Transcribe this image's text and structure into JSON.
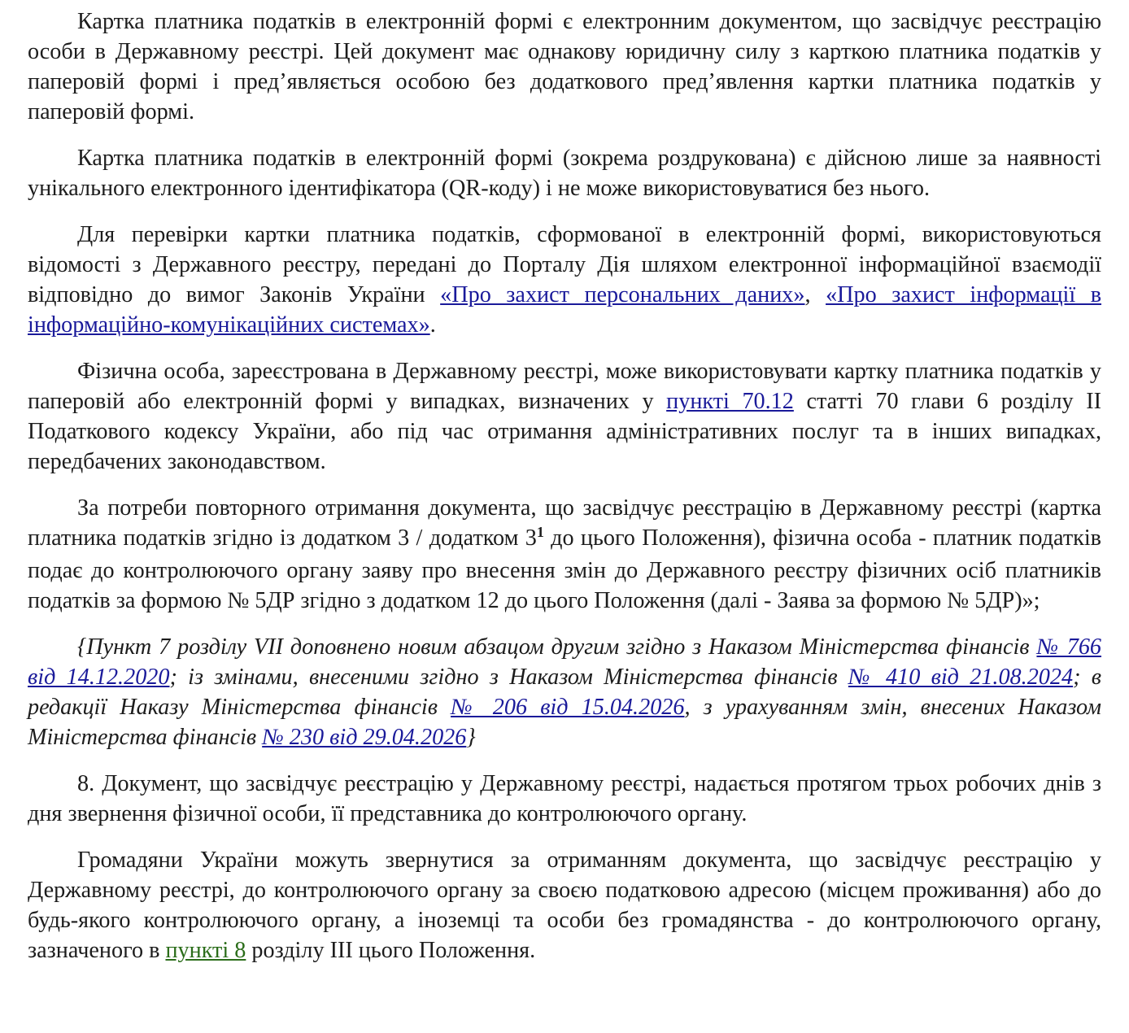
{
  "paragraphs": {
    "p1": "Картка платника податків в електронній формі є електронним документом, що засвідчує реєстрацію особи в Державному реєстрі. Цей документ має однакову юридичну силу з карткою платника податків у паперовій формі і пред’являється особою без додаткового пред’явлення картки платника податків у паперовій формі.",
    "p2": "Картка платника податків в електронній формі (зокрема роздрукована) є дійсною лише за наявності унікального електронного ідентифікатора (QR-коду) і не може використовуватися без нього.",
    "p3": {
      "text1": "Для перевірки картки платника податків, сформованої в електронній формі, використовуються відомості з Державного реєстру, передані до Порталу Дія шляхом електронної інформаційної взаємодії відповідно до вимог Законів України ",
      "link1": "«Про захист персональних даних»",
      "sep": ", ",
      "link2": "«Про захист інформації в інформаційно-комунікаційних системах»",
      "end": "."
    },
    "p4": {
      "text1": "Фізична особа, зареєстрована в Державному реєстрі, може використовувати картку платника податків у паперовій або електронній формі у випадках, визначених у ",
      "link1": "пункті 70.12",
      "text2": " статті 70 глави 6 розділу ІІ Податкового кодексу України, або під час отримання адміністративних послуг та в інших випадках, передбачених законодавством."
    },
    "p5": {
      "text1": "За потреби повторного отримання документа, що засвідчує реєстрацію в Державному реєстрі (картка платника податків згідно із додатком 3 / додатком 3",
      "sup": "1",
      "text2": " до цього Положення), фізична особа - платник податків подає до контролюючого органу заяву про внесення змін до Державного реєстру фізичних осіб платників податків за формою № 5ДР згідно з додатком 12 до цього Положення (далі - Заява за формою № 5ДР)»;"
    },
    "note": {
      "text1": "{Пункт 7 розділу VII доповнено новим абзацом другим згідно з Наказом Міністерства фінансів ",
      "link1": "№ 766 від 14.12.2020",
      "text2": "; із змінами, внесеними згідно з Наказом Міністерства фінансів ",
      "link2": "№ 410 від 21.08.2024",
      "text3": "; в редакції Наказу Міністерства фінансів ",
      "link3": "№ 206 від 15.04.2026",
      "text4": ", з урахуванням змін, внесених Наказом Міністерства фінансів ",
      "link4": "№ 230 від 29.04.2026",
      "text5": "}"
    },
    "p6": "8. Документ, що засвідчує реєстрацію у Державному реєстрі, надається протягом трьох робочих днів з дня звернення фізичної особи, її представника до контролюючого органу.",
    "p7": {
      "text1": "Громадяни України можуть звернутися за отриманням документа, що засвідчує реєстрацію у Державному реєстрі, до контролюючого органу за своєю податковою адресою (місцем проживання) або до будь-якого контролюючого органу, а іноземці та особи без громадянства - до контролюючого органу, зазначеного в ",
      "link1": "пункті 8",
      "text2": " розділу ІІІ цього Положення."
    }
  },
  "colors": {
    "text": "#1c1c1c",
    "link": "#1a1a9a",
    "link_local": "#2b6d1a"
  }
}
